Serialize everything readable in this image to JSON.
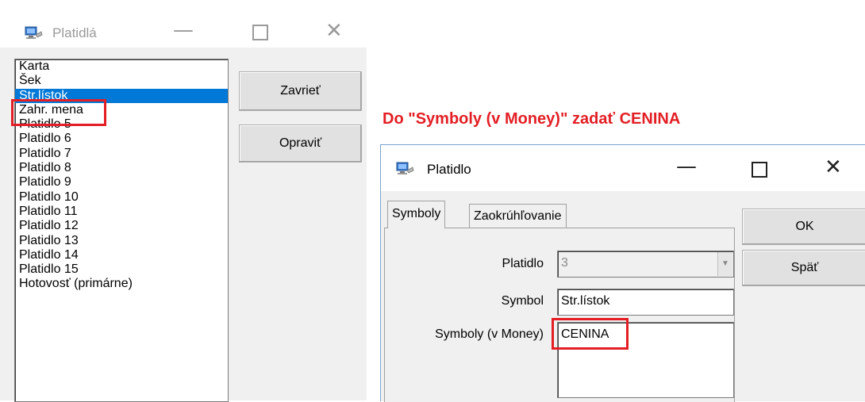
{
  "platidla_window": {
    "title": "Platidlá",
    "minimize": "—",
    "close": "✕",
    "list_items": [
      "Karta",
      "Šek",
      "Str.lístok",
      "Zahr. mena",
      "Platidlo 5",
      "Platidlo 6",
      "Platidlo 7",
      "Platidlo 8",
      "Platidlo 9",
      "Platidlo 10",
      "Platidlo 11",
      "Platidlo 12",
      "Platidlo 13",
      "Platidlo 14",
      "Platidlo 15",
      "Hotovosť (primárne)"
    ],
    "selected_item": "Str.lístok",
    "close_button": "Zavrieť",
    "edit_button": "Opraviť"
  },
  "instruction": "Do \"Symboly (v Money)\" zadať CENINA",
  "platidlo_window": {
    "title": "Platidlo",
    "minimize": "—",
    "close": "✕",
    "tabs": [
      "Symboly",
      "Zaokrúhľovanie"
    ],
    "active_tab": "Symboly",
    "ok_button": "OK",
    "back_button": "Späť",
    "fields": {
      "platidlo_label": "Platidlo",
      "platidlo_value": "3",
      "symbol_label": "Symbol",
      "symbol_value": "Str.lístok",
      "symboly_money_label": "Symboly (v Money)",
      "symboly_money_value": "CENINA"
    }
  },
  "colors": {
    "highlight_red": "#e31e24",
    "selection_blue": "#0078d7"
  },
  "icons": {
    "app_icon": "computer-network-icon"
  }
}
